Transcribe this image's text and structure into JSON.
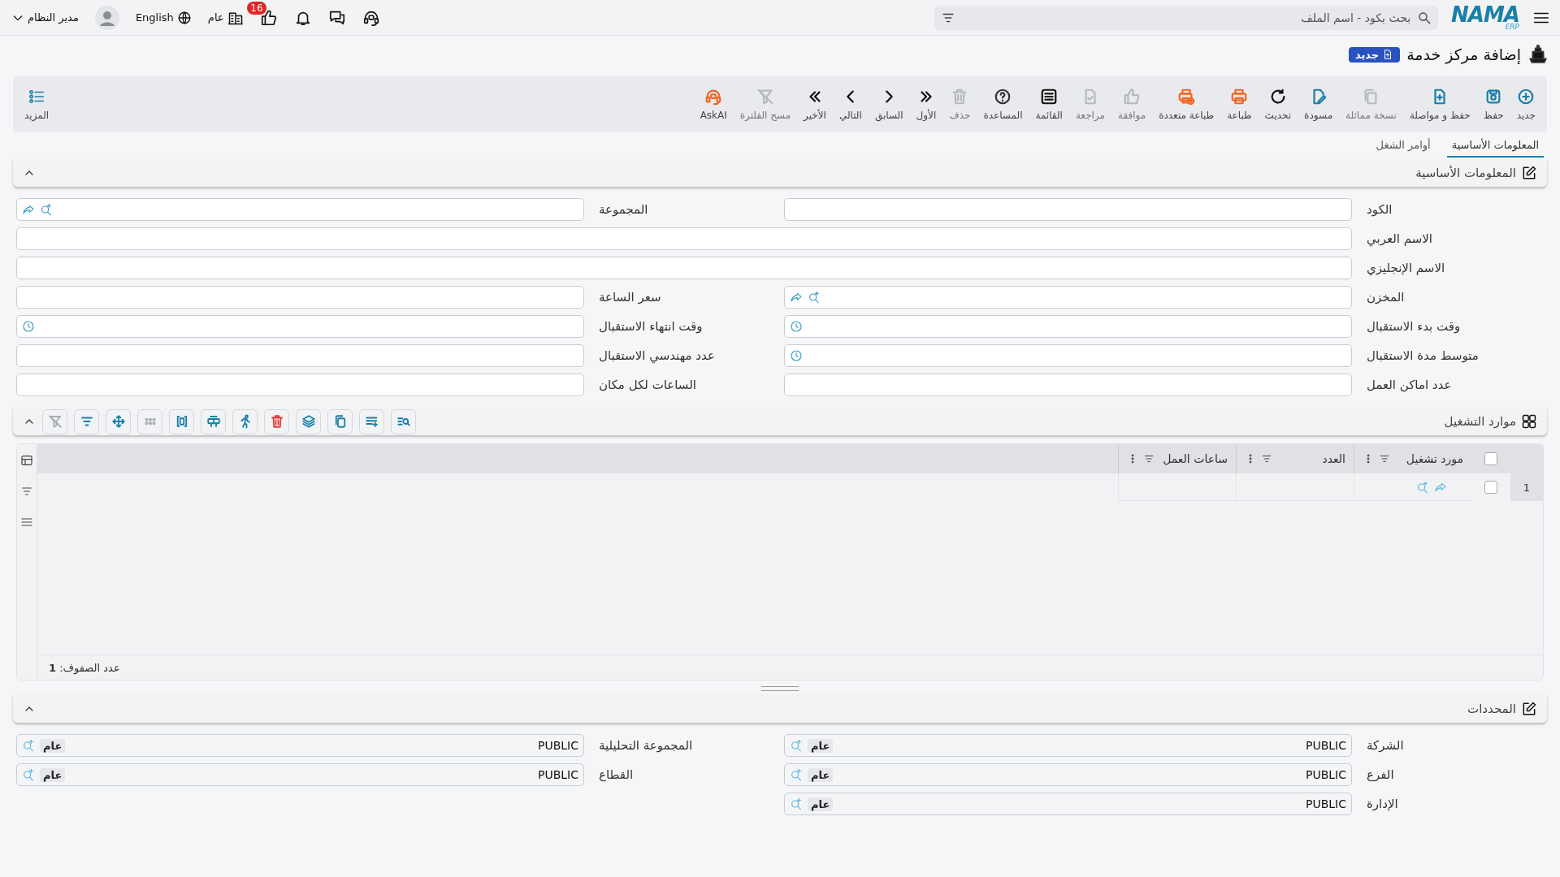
{
  "top_bar": {
    "logo": {
      "text": "NAMA",
      "sub": "ERP"
    },
    "search": {
      "placeholder": "بحث بكود - اسم الملف"
    },
    "notifications_badge": "16",
    "company": "عام",
    "language": "English",
    "user": "مدير النظام"
  },
  "page": {
    "title": "إضافة مركز خدمة",
    "badge": "جديد"
  },
  "toolbar": [
    {
      "label": "جديد",
      "color": "#1a7fa8",
      "disabled": false
    },
    {
      "label": "حفظ",
      "color": "#1a7fa8",
      "disabled": false
    },
    {
      "label": "حفظ و مواصلة",
      "color": "#1a7fa8",
      "disabled": false
    },
    {
      "label": "نسخة مماثلة",
      "color": "#b5b8bd",
      "disabled": true
    },
    {
      "label": "مسودة",
      "color": "#1a7fa8",
      "disabled": false
    },
    {
      "label": "تحديث",
      "color": "#111111",
      "disabled": false
    },
    {
      "label": "طباعة",
      "color": "#f26522",
      "disabled": false
    },
    {
      "label": "طباعة متعددة",
      "color": "#f26522",
      "disabled": false
    },
    {
      "label": "موافقة",
      "color": "#b5b8bd",
      "disabled": true
    },
    {
      "label": "مراجعة",
      "color": "#b5b8bd",
      "disabled": true
    },
    {
      "label": "القائمة",
      "color": "#111111",
      "disabled": false
    },
    {
      "label": "المساعدة",
      "color": "#333333",
      "disabled": false
    },
    {
      "label": "حذف",
      "color": "#b5b8bd",
      "disabled": true
    },
    {
      "label": "الأول",
      "color": "#111111",
      "disabled": false
    },
    {
      "label": "السابق",
      "color": "#111111",
      "disabled": false
    },
    {
      "label": "التالي",
      "color": "#111111",
      "disabled": false
    },
    {
      "label": "الأخير",
      "color": "#111111",
      "disabled": false
    },
    {
      "label": "مسح الفلترة",
      "color": "#b5b8bd",
      "disabled": true
    },
    {
      "label": "AskAI",
      "color": "#f26522",
      "disabled": false
    }
  ],
  "more_button": "المزيد",
  "tabs": [
    {
      "label": "المعلومات الأساسية",
      "selected": true
    },
    {
      "label": "أوامر الشغل",
      "selected": false
    }
  ],
  "basic_info": {
    "title": "المعلومات الأساسية",
    "expanded": true,
    "fields": [
      {
        "label": "الكود",
        "kind": "text",
        "wide": false
      },
      {
        "label": "المجموعة",
        "kind": "lookup",
        "wide": false
      },
      {
        "label": "الاسم العربي",
        "kind": "text",
        "wide": true
      },
      {
        "label": "الاسم الإنجليزي",
        "kind": "text",
        "wide": true
      },
      {
        "label": "المخزن",
        "kind": "lookup",
        "wide": false
      },
      {
        "label": "سعر الساعة",
        "kind": "text",
        "wide": false
      },
      {
        "label": "وقت بدء الاستقبال",
        "kind": "time",
        "wide": false
      },
      {
        "label": "وقت انتهاء الاستقبال",
        "kind": "time",
        "wide": false
      },
      {
        "label": "متوسط مدة الاستقبال",
        "kind": "time",
        "wide": false
      },
      {
        "label": "عدد مهندسي الاستقبال",
        "kind": "text",
        "wide": false
      },
      {
        "label": "عدد اماكن العمل",
        "kind": "text",
        "wide": false
      },
      {
        "label": "الساعات لكل مكان",
        "kind": "text",
        "wide": false
      }
    ]
  },
  "resources": {
    "title": "موارد التشغيل",
    "expanded": true,
    "tools": [
      {
        "color": "#1a7fa8"
      },
      {
        "color": "#1a7fa8"
      },
      {
        "color": "#1a7fa8"
      },
      {
        "color": "#1a7fa8"
      },
      {
        "color": "#e53935"
      },
      {
        "color": "#1a7fa8"
      },
      {
        "color": "#1a7fa8"
      },
      {
        "color": "#1a7fa8"
      },
      {
        "color": "#a9adb3"
      },
      {
        "color": "#1a7fa8"
      },
      {
        "color": "#1a7fa8"
      },
      {
        "color": "#a9adb3"
      }
    ],
    "columns": [
      "مورد تشغيل",
      "العدد",
      "ساعات العمل"
    ],
    "rows": [
      {
        "number": "1",
        "checked": false
      }
    ],
    "header_checked": false,
    "footer": "عدد الصفوف: **1**"
  },
  "dimensions": {
    "title": "المحددات",
    "expanded": true,
    "fields": [
      {
        "label": "الشركة",
        "value": "PUBLIC",
        "tag": "عام"
      },
      {
        "label": "المجموعة التحليلية",
        "value": "PUBLIC",
        "tag": "عام"
      },
      {
        "label": "الفرع",
        "value": "PUBLIC",
        "tag": "عام"
      },
      {
        "label": "القطاع",
        "value": "PUBLIC",
        "tag": "عام"
      },
      {
        "label": "الإدارة",
        "value": "PUBLIC",
        "tag": "عام"
      }
    ]
  }
}
